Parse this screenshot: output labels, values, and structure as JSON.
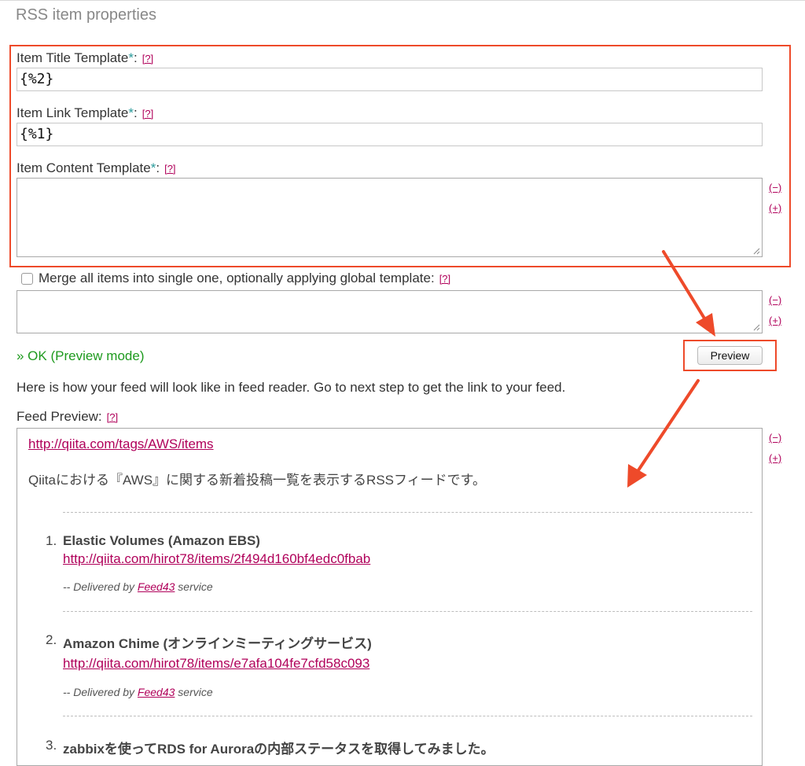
{
  "section_title": "RSS item properties",
  "required_mark": "*",
  "colon": ":",
  "help_link": "[?]",
  "fields": {
    "title": {
      "label": "Item Title Template",
      "value": "{%2}"
    },
    "link": {
      "label": "Item Link Template",
      "value": "{%1}"
    },
    "content": {
      "label": "Item Content Template",
      "value": ""
    }
  },
  "textarea_controls": {
    "shrink": "(−)",
    "grow": "(+)"
  },
  "merge": {
    "checked": false,
    "label": "Merge all items into single one, optionally applying global template:",
    "value": ""
  },
  "status": "» OK (Preview mode)",
  "preview_button": "Preview",
  "info_text": "Here is how your feed will look like in feed reader. Go to next step to get the link to your feed.",
  "feed_preview": {
    "label": "Feed Preview:",
    "feed_url": "http://qiita.com/tags/AWS/items",
    "description": "Qiitaにおける『AWS』に関する新着投稿一覧を表示するRSSフィードです。",
    "items": [
      {
        "num": "1.",
        "title": "Elastic Volumes (Amazon EBS)",
        "url": "http://qiita.com/hirot78/items/2f494d160bf4edc0fbab",
        "delivered_prefix": "-- Delivered by ",
        "delivered_link": "Feed43",
        "delivered_suffix": " service"
      },
      {
        "num": "2.",
        "title": "Amazon Chime (オンラインミーティングサービス)",
        "url": "http://qiita.com/hirot78/items/e7afa104fe7cfd58c093",
        "delivered_prefix": "-- Delivered by ",
        "delivered_link": "Feed43",
        "delivered_suffix": " service"
      },
      {
        "num": "3.",
        "title": "zabbixを使ってRDS for Auroraの内部ステータスを取得してみました。"
      }
    ]
  },
  "colors": {
    "link": "#b0005a",
    "required": "#2a9b9b",
    "ok": "#1e9a1e",
    "annotation": "#ee4a2a"
  }
}
